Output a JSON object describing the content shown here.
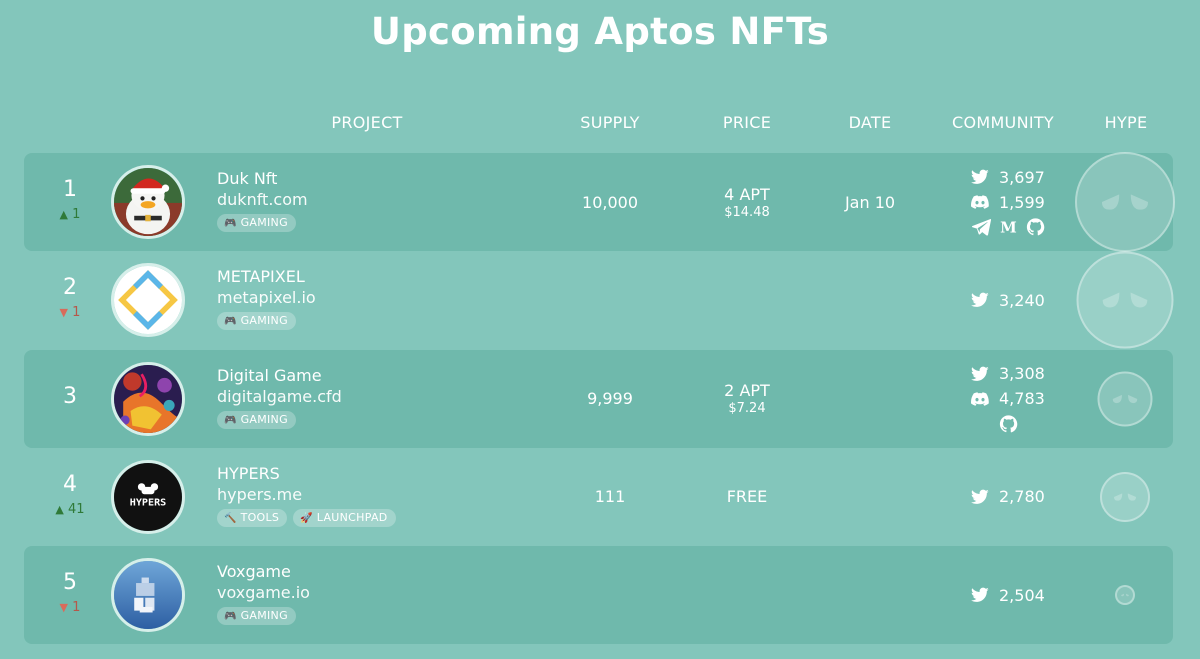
{
  "page": {
    "title": "Upcoming Aptos NFTs"
  },
  "columns": {
    "project": "PROJECT",
    "supply": "SUPPLY",
    "price": "PRICE",
    "date": "DATE",
    "community": "COMMUNITY",
    "hype": "HYPE"
  },
  "rows": [
    {
      "rank": "1",
      "change_dir": "up",
      "change": "1",
      "avatar": "duck-santa-avatar",
      "name": "Duk Nft",
      "url": "duknft.com",
      "tags": [
        {
          "icon": "gamepad-icon",
          "label": "GAMING"
        }
      ],
      "supply": "10,000",
      "price": "4 APT",
      "price_usd": "$14.48",
      "date": "Jan 10",
      "twitter": "3,697",
      "discord": "1,599",
      "links": [
        "telegram-icon",
        "medium-icon",
        "github-icon"
      ],
      "hype_level": 1.0
    },
    {
      "rank": "2",
      "change_dir": "down",
      "change": "1",
      "avatar": "metapixel-logo-avatar",
      "name": "METAPIXEL",
      "url": "metapixel.io",
      "tags": [
        {
          "icon": "gamepad-icon",
          "label": "GAMING"
        }
      ],
      "supply": "",
      "price": "",
      "price_usd": "",
      "date": "",
      "twitter": "3,240",
      "discord": "",
      "links": [],
      "hype_level": 0.97
    },
    {
      "rank": "3",
      "change_dir": "",
      "change": "",
      "avatar": "digital-game-art-avatar",
      "name": "Digital Game",
      "url": "digitalgame.cfd",
      "tags": [
        {
          "icon": "gamepad-icon",
          "label": "GAMING"
        }
      ],
      "supply": "9,999",
      "price": "2 APT",
      "price_usd": "$7.24",
      "date": "",
      "twitter": "3,308",
      "discord": "4,783",
      "links": [
        "github-icon"
      ],
      "hype_level": 0.55
    },
    {
      "rank": "4",
      "change_dir": "up",
      "change": "41",
      "avatar": "hypers-logo-avatar",
      "name": "HYPERS",
      "url": "hypers.me",
      "tags": [
        {
          "icon": "hammer-icon",
          "label": "TOOLS"
        },
        {
          "icon": "rocket-icon",
          "label": "LAUNCHPAD"
        }
      ],
      "supply": "111",
      "price": "FREE",
      "price_usd": "",
      "date": "",
      "twitter": "2,780",
      "discord": "",
      "links": [],
      "hype_level": 0.5
    },
    {
      "rank": "5",
      "change_dir": "down",
      "change": "1",
      "avatar": "voxgame-logo-avatar",
      "name": "Voxgame",
      "url": "voxgame.io",
      "tags": [
        {
          "icon": "gamepad-icon",
          "label": "GAMING"
        }
      ],
      "supply": "",
      "price": "",
      "price_usd": "",
      "date": "",
      "twitter": "2,504",
      "discord": "",
      "links": [],
      "hype_level": 0.2
    }
  ],
  "colors": {
    "background": "#83c6bb",
    "row_stripe": "#6fb9ac",
    "rank_up": "#2f7a38",
    "rank_down": "#d86b5b"
  }
}
